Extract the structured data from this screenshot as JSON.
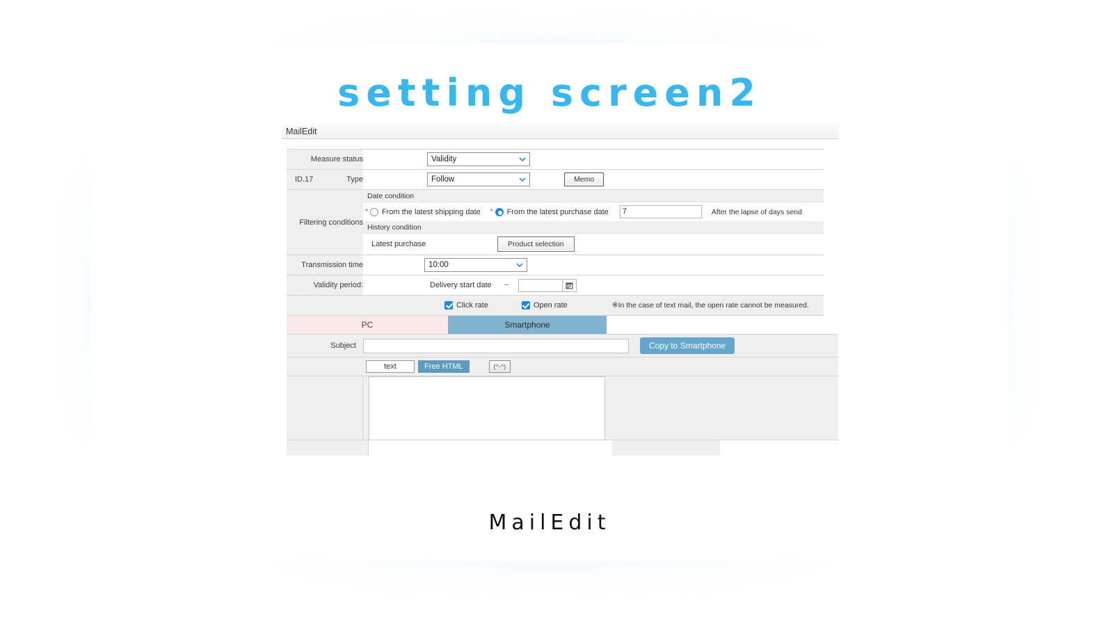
{
  "page": {
    "headline": "setting screen2",
    "caption": "MailEdit",
    "accent_color": "#37b6f0"
  },
  "app": {
    "title": "MailEdit",
    "rows": {
      "measure_status": {
        "label": "Measure status",
        "select_value": "Validity"
      },
      "id_type": {
        "id_label": "ID.17",
        "type_label": "Type",
        "select_value": "Follow",
        "memo_button": "Memo"
      },
      "filtering_conditions": {
        "label": "Filtering conditions",
        "date_condition_header": "Date condition",
        "radio_shipping": {
          "required_mark": "*",
          "label": "From the latest shipping date",
          "selected": false
        },
        "radio_purchase": {
          "required_mark": "*",
          "label": "From the latest purchase date",
          "selected": true
        },
        "days_value": "7",
        "days_suffix": "After the lapse of days send",
        "history_condition_header": "History condition",
        "latest_purchase_label": "Latest purchase",
        "product_selection_button": "Product selection"
      },
      "transmission_time": {
        "label": "Transmission time",
        "select_value": "10:00"
      },
      "validity_period": {
        "label": "Validity period:",
        "start_label": "Delivery start date",
        "separator": "~",
        "end_value": "",
        "calendar_icon": "calendar-icon"
      },
      "measurement": {
        "click_rate_label": "Click rate",
        "click_rate_checked": true,
        "open_rate_label": "Open rate",
        "open_rate_checked": true,
        "note": "※In the case of text mail, the open rate cannot be measured."
      }
    },
    "device_tabs": [
      {
        "label": "PC",
        "active": false,
        "color": "#fbe9e9"
      },
      {
        "label": "Smartphone",
        "active": true,
        "color": "#7fb4d0"
      }
    ],
    "subject": {
      "label": "Subject",
      "value": "",
      "copy_button": "Copy to Smartphone"
    },
    "editor_toolbar": {
      "text_button": "text",
      "free_html_button": "Free HTML",
      "emoticon_button": "(^-^)"
    },
    "editor": {
      "content": ""
    }
  }
}
